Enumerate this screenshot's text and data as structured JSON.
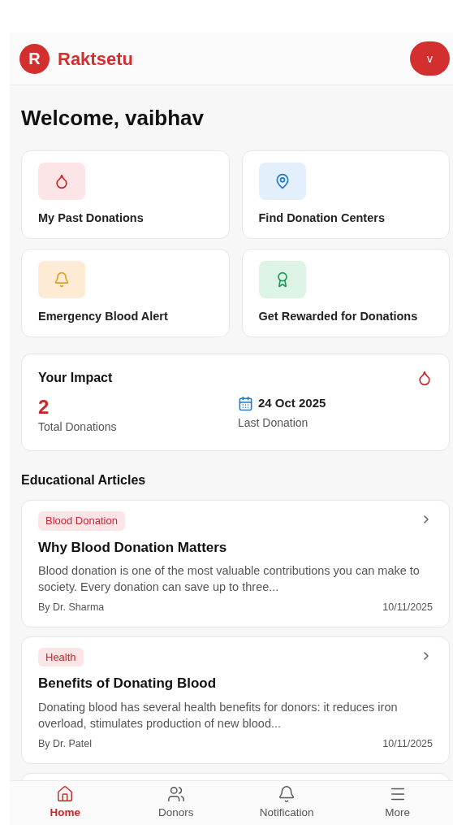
{
  "header": {
    "logo_letter": "R",
    "app_name": "Raktsetu",
    "avatar_letter": "v"
  },
  "welcome": "Welcome, vaibhav",
  "quick_actions": [
    {
      "kind": "drop",
      "label": "My Past Donations"
    },
    {
      "kind": "pin",
      "label": "Find Donation Centers"
    },
    {
      "kind": "bell",
      "label": "Emergency Blood Alert"
    },
    {
      "kind": "award",
      "label": "Get Rewarded for Donations"
    }
  ],
  "impact": {
    "title": "Your Impact",
    "total": "2",
    "total_label": "Total Donations",
    "last_date": "24 Oct 2025",
    "last_label": "Last Donation"
  },
  "articles_heading": "Educational Articles",
  "articles": [
    {
      "tag": "Blood Donation",
      "title": "Why Blood Donation Matters",
      "summary": "Blood donation is one of the most valuable contributions you can make to society. Every donation can save up to three...",
      "author": "By Dr. Sharma",
      "date": "10/11/2025"
    },
    {
      "tag": "Health",
      "title": "Benefits of Donating Blood",
      "summary": "Donating blood has several health benefits for donors: it reduces iron overload, stimulates production of new blood...",
      "author": "By Dr. Patel",
      "date": "10/11/2025"
    }
  ],
  "nav": [
    {
      "kind": "home",
      "label": "Home",
      "selected": true
    },
    {
      "kind": "donors",
      "label": "Donors",
      "selected": false
    },
    {
      "kind": "notification",
      "label": "Notification",
      "selected": false
    },
    {
      "kind": "more",
      "label": "More",
      "selected": false
    }
  ]
}
